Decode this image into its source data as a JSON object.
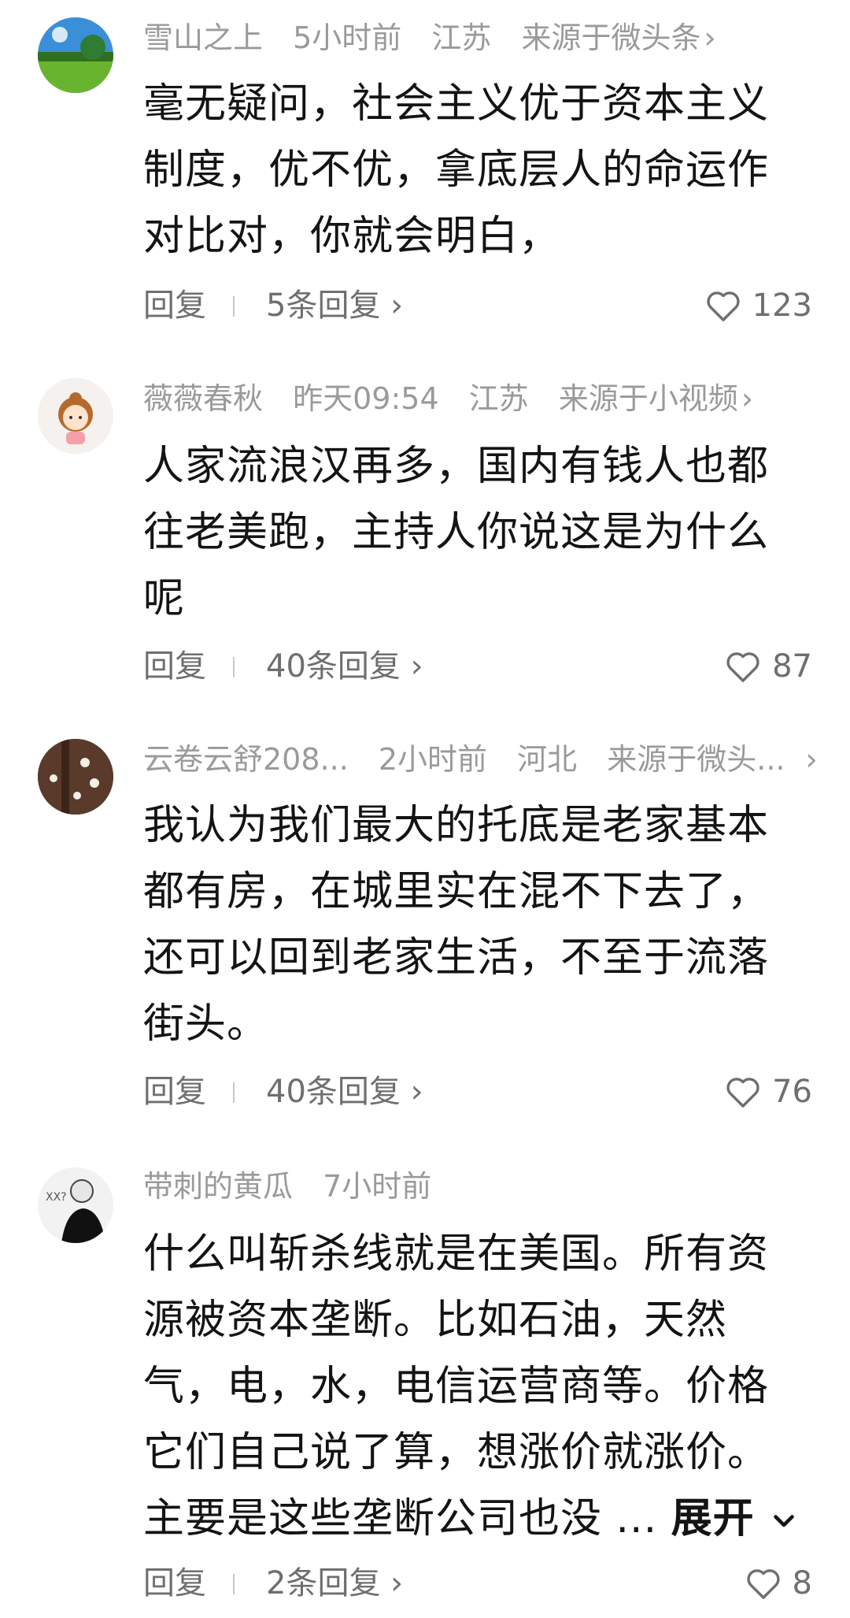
{
  "comments": [
    {
      "username": "雪山之上",
      "time": "5小时前",
      "location": "江苏",
      "source": "来源于微头条",
      "text_lines": [
        "毫无疑问，社会主义优于资本主义",
        "制度，优不优，拿底层人的命运作",
        "对比对，你就会明白，"
      ],
      "reply_label": "回复",
      "replies_label": "5条回复",
      "likes": "123"
    },
    {
      "username": "薇薇春秋",
      "time": "昨天09:54",
      "location": "江苏",
      "source": "来源于小视频",
      "text_lines": [
        "人家流浪汉再多，国内有钱人也都",
        "往老美跑，主持人你说这是为什么",
        "呢"
      ],
      "reply_label": "回复",
      "replies_label": "40条回复",
      "likes": "87"
    },
    {
      "username": "云卷云舒208...",
      "time": "2小时前",
      "location": "河北",
      "source": "来源于微头...",
      "text_lines": [
        "我认为我们最大的托底是老家基本",
        "都有房，在城里实在混不下去了，",
        "还可以回到老家生活，不至于流落",
        "街头。"
      ],
      "reply_label": "回复",
      "replies_label": "40条回复",
      "likes": "76"
    },
    {
      "username": "带刺的黄瓜",
      "time": "7小时前",
      "text_lines": [
        "什么叫斩杀线就是在美国。所有资",
        "源被资本垄断。比如石油，天然",
        "气，电，水，电信运营商等。价格",
        "它们自己说了算，想涨价就涨价。",
        "主要是这些垄断公司也没 ..."
      ],
      "expand_label": "展开",
      "reply_label": "回复",
      "replies_label": "2条回复",
      "likes": "8"
    }
  ],
  "icons": {
    "like": "heart-outline-icon",
    "chevron": "chevron-right-icon",
    "expand": "chevron-down-icon"
  },
  "colors": {
    "meta": "#9a9a9a",
    "text": "#141414",
    "action": "#6f6f6f"
  }
}
